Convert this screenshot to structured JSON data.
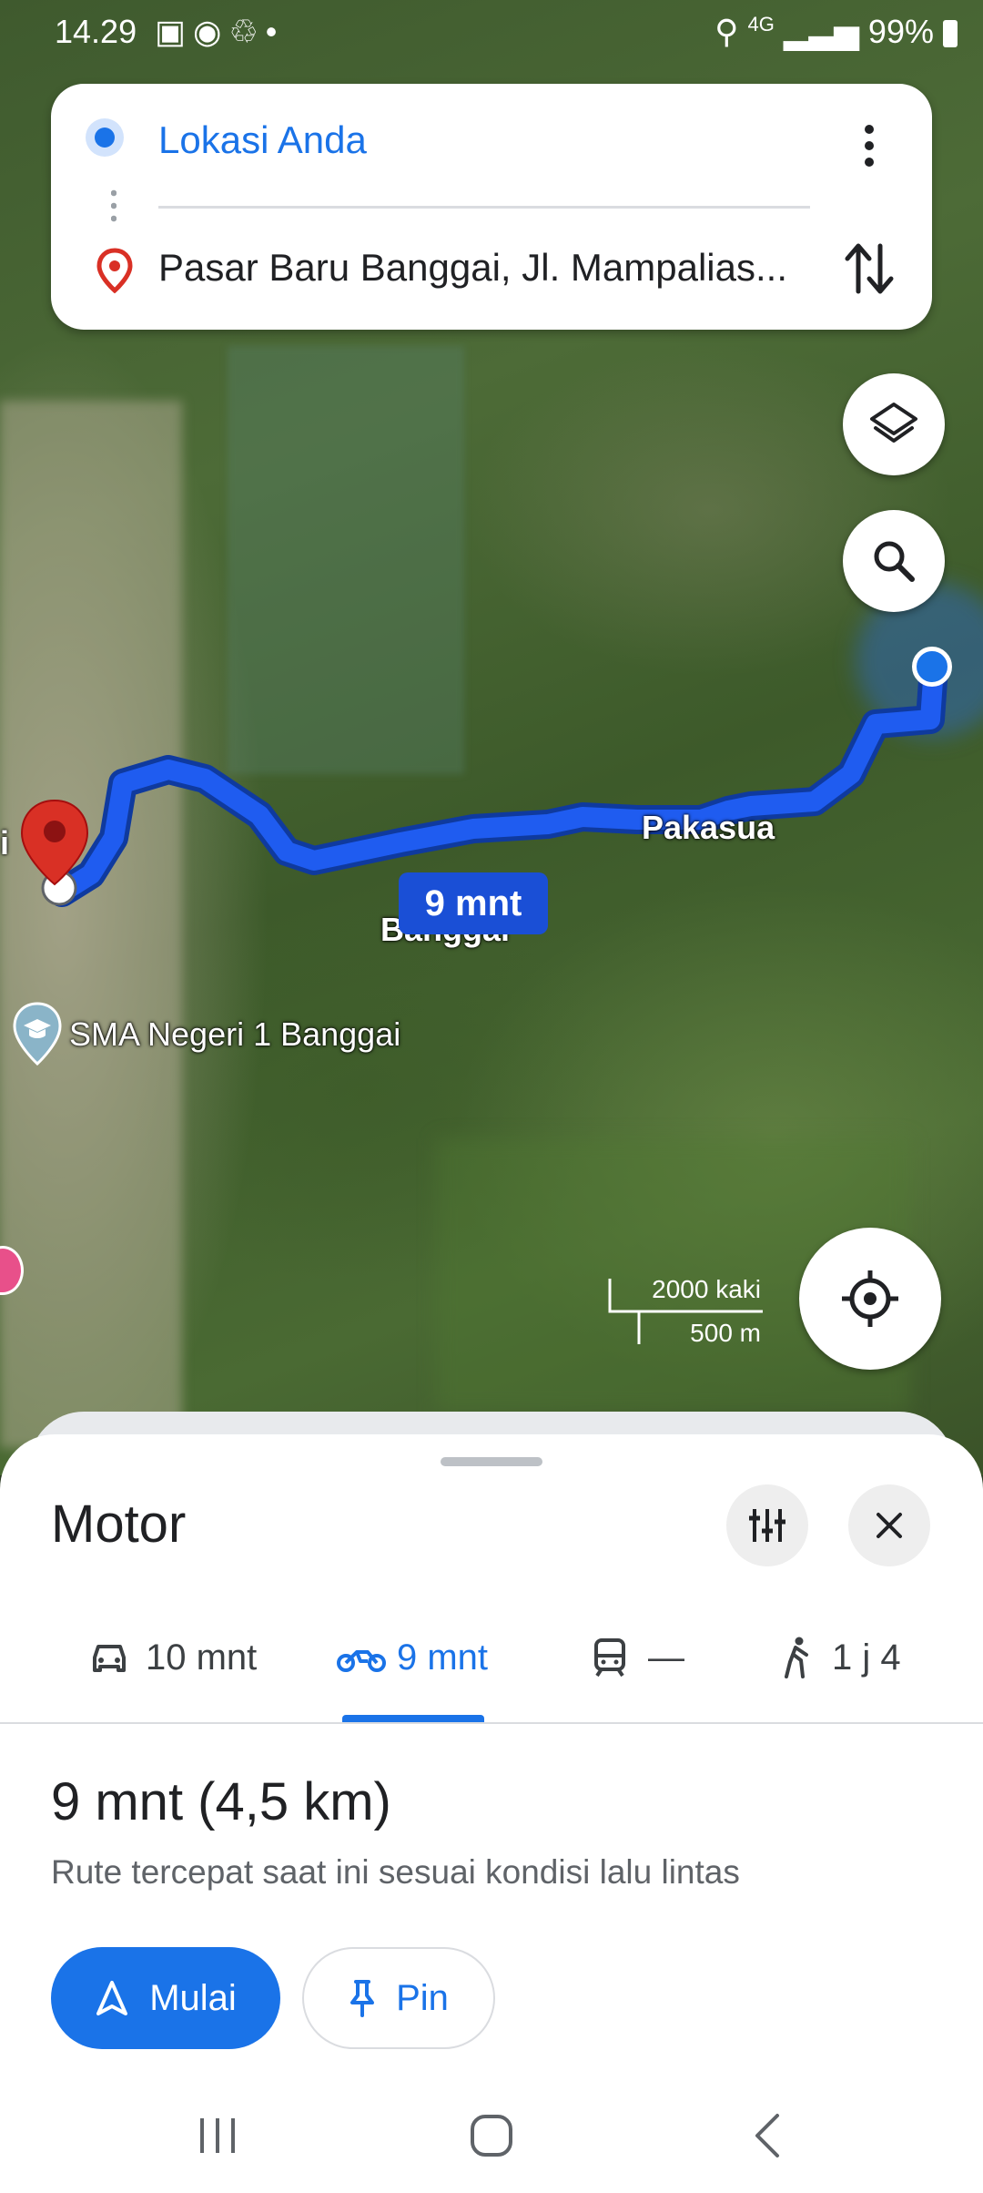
{
  "status_bar": {
    "time": "14.29",
    "left_icons": [
      "image-icon",
      "line-icon",
      "sync-icon",
      "dot-icon"
    ],
    "network": "4G",
    "battery": "99%"
  },
  "directions": {
    "origin": "Lokasi Anda",
    "destination": "Pasar Baru Banggai, Jl. Mampalias..."
  },
  "map": {
    "labels": {
      "pakasua": "Pakasua",
      "banggai": "Banggai",
      "poi_school": "SMA Negeri 1 Banggai",
      "left_edge": "i"
    },
    "route_time": "9 mnt",
    "scale": {
      "imperial": "2000 kaki",
      "metric": "500 m"
    }
  },
  "sheet": {
    "title": "Motor",
    "tabs": [
      {
        "icon": "car-icon",
        "label": "10 mnt"
      },
      {
        "icon": "motorcycle-icon",
        "label": "9 mnt"
      },
      {
        "icon": "transit-icon",
        "label": "—"
      },
      {
        "icon": "walk-icon",
        "label": "1 j 4"
      }
    ],
    "summary": "9 mnt (4,5 km)",
    "description": "Rute tercepat saat ini sesuai kondisi lalu lintas",
    "start_label": "Mulai",
    "pin_label": "Pin"
  },
  "colors": {
    "accent": "#1a73e8",
    "route": "#1a4fd6",
    "destination_pin": "#d93025"
  }
}
